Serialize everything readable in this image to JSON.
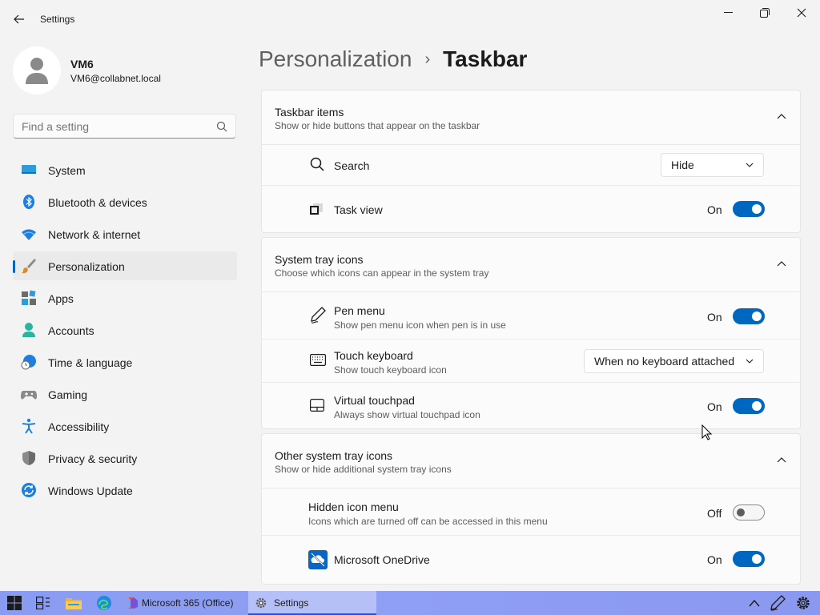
{
  "window": {
    "app_title": "Settings"
  },
  "user": {
    "name": "VM6",
    "email": "VM6@collabnet.local"
  },
  "search": {
    "placeholder": "Find a setting"
  },
  "sidebar": {
    "items": [
      {
        "label": "System",
        "icon": "monitor-icon"
      },
      {
        "label": "Bluetooth & devices",
        "icon": "bluetooth-icon"
      },
      {
        "label": "Network & internet",
        "icon": "wifi-icon"
      },
      {
        "label": "Personalization",
        "icon": "paintbrush-icon",
        "selected": true
      },
      {
        "label": "Apps",
        "icon": "apps-icon"
      },
      {
        "label": "Accounts",
        "icon": "person-icon"
      },
      {
        "label": "Time & language",
        "icon": "globe-clock-icon"
      },
      {
        "label": "Gaming",
        "icon": "gamepad-icon"
      },
      {
        "label": "Accessibility",
        "icon": "accessibility-icon"
      },
      {
        "label": "Privacy & security",
        "icon": "shield-icon"
      },
      {
        "label": "Windows Update",
        "icon": "update-icon"
      }
    ]
  },
  "header": {
    "parent": "Personalization",
    "current": "Taskbar"
  },
  "groups": {
    "taskbar_items": {
      "title": "Taskbar items",
      "subtitle": "Show or hide buttons that appear on the taskbar",
      "search": {
        "label": "Search",
        "value": "Hide"
      },
      "task_view": {
        "label": "Task view",
        "state": "On"
      }
    },
    "system_tray": {
      "title": "System tray icons",
      "subtitle": "Choose which icons can appear in the system tray",
      "pen_menu": {
        "label": "Pen menu",
        "sub": "Show pen menu icon when pen is in use",
        "state": "On"
      },
      "touch_keyboard": {
        "label": "Touch keyboard",
        "sub": "Show touch keyboard icon",
        "value": "When no keyboard attached"
      },
      "virtual_touchpad": {
        "label": "Virtual touchpad",
        "sub": "Always show virtual touchpad icon",
        "state": "On"
      }
    },
    "other_tray": {
      "title": "Other system tray icons",
      "subtitle": "Show or hide additional system tray icons",
      "hidden_menu": {
        "label": "Hidden icon menu",
        "sub": "Icons which are turned off can be accessed in this menu",
        "state": "Off"
      },
      "onedrive": {
        "label": "Microsoft OneDrive",
        "state": "On"
      }
    }
  },
  "taskbar": {
    "apps": [
      {
        "label": "Microsoft 365 (Office)"
      },
      {
        "label": "Settings"
      }
    ]
  },
  "colors": {
    "accent": "#0067c0",
    "taskbar": "#8f9ff3"
  }
}
